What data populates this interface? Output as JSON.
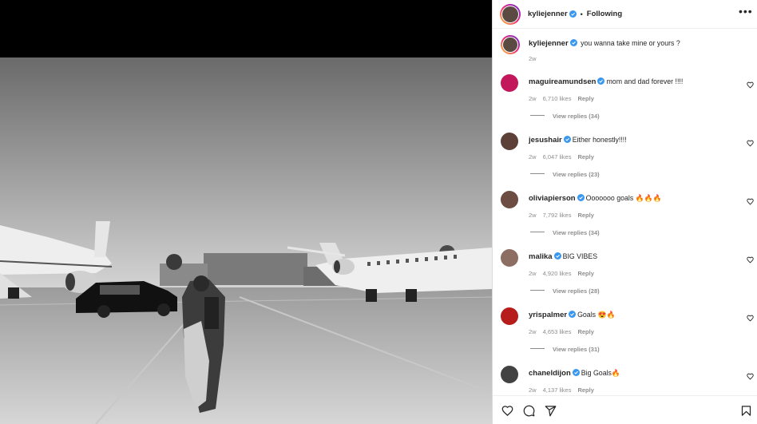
{
  "post": {
    "author": "kyliejenner",
    "follow_label": "Following",
    "dot": "•",
    "more_label": "•••",
    "caption": {
      "username": "kyliejenner",
      "text": "you wanna take mine or yours ?",
      "time": "2w"
    }
  },
  "comments": [
    {
      "username": "maguireamundsen",
      "text": "mom and dad forever !!!!",
      "time": "2w",
      "likes": "6,710 likes",
      "reply": "Reply",
      "replies": "View replies (34)",
      "avatar_color": "#c2185b"
    },
    {
      "username": "jesushair",
      "text": "Either honestly!!!!",
      "time": "2w",
      "likes": "6,047 likes",
      "reply": "Reply",
      "replies": "View replies (23)",
      "avatar_color": "#5d4037"
    },
    {
      "username": "oliviapierson",
      "text": "Ooooooo goals 🔥🔥🔥",
      "time": "2w",
      "likes": "7,792 likes",
      "reply": "Reply",
      "replies": "View replies (34)",
      "avatar_color": "#6d4c41"
    },
    {
      "username": "malika",
      "text": "BIG VIBES",
      "time": "2w",
      "likes": "4,920 likes",
      "reply": "Reply",
      "replies": "View replies (28)",
      "avatar_color": "#8d6e63"
    },
    {
      "username": "yrispalmer",
      "text": "Goals 😍🔥",
      "time": "2w",
      "likes": "4,653 likes",
      "reply": "Reply",
      "replies": "View replies (31)",
      "avatar_color": "#b71c1c"
    },
    {
      "username": "chaneldijon",
      "text": "Big Goals🔥",
      "time": "2w",
      "likes": "4,137 likes",
      "reply": "Reply",
      "replies": "",
      "avatar_color": "#424242"
    }
  ],
  "icons": {
    "heart": "heart-icon",
    "comment": "comment-icon",
    "share": "share-icon",
    "bookmark": "bookmark-icon",
    "verified": "verified-badge-icon",
    "more": "more-options-icon"
  },
  "colors": {
    "verified": "#3897f0",
    "text": "#262626",
    "muted": "#8e8e8e"
  }
}
